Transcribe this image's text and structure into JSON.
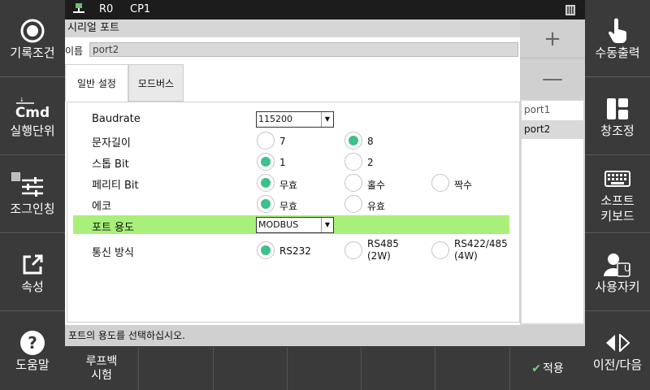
{
  "top_status": {
    "indicator_r": "R0",
    "indicator_cp": "CP1"
  },
  "left_sidebar": [
    {
      "label": "기록조건",
      "icon": "record-circle-icon"
    },
    {
      "label": "실행단위",
      "icon": "cmd-icon",
      "icon_text": "Cmd"
    },
    {
      "label": "조그인칭",
      "icon": "sliders-icon"
    },
    {
      "label": "속성",
      "icon": "external-link-icon"
    },
    {
      "label": "도움말",
      "icon": "help-icon"
    }
  ],
  "right_sidebar": [
    {
      "label": "수동출력",
      "icon": "hand-pointer-icon"
    },
    {
      "label": "창조정",
      "icon": "window-layout-icon"
    },
    {
      "label": "소프트\n키보드",
      "icon": "keyboard-icon"
    },
    {
      "label": "사용자키",
      "icon": "user-key-icon",
      "icon_text": "U"
    },
    {
      "label": "이전/다음",
      "icon": "prev-next-icon"
    }
  ],
  "window": {
    "title": "시리얼 포트",
    "name_label": "이름",
    "name_value": "port2"
  },
  "tabs": [
    {
      "label": "일반 설정",
      "active": true
    },
    {
      "label": "모드버스",
      "active": false
    }
  ],
  "settings": {
    "baudrate": {
      "label": "Baudrate",
      "value": "115200"
    },
    "char_length": {
      "label": "문자길이",
      "options": [
        "7",
        "8"
      ],
      "selected": "8"
    },
    "stop_bit": {
      "label": "스톱 Bit",
      "options": [
        "1",
        "2"
      ],
      "selected": "1"
    },
    "parity_bit": {
      "label": "페리티 Bit",
      "options": [
        "무효",
        "홀수",
        "짝수"
      ],
      "selected": "무효"
    },
    "echo": {
      "label": "에코",
      "options": [
        "무효",
        "유효"
      ],
      "selected": "무효"
    },
    "port_usage": {
      "label": "포트 용도",
      "value": "MODBUS"
    },
    "comm_method": {
      "label": "통신 방식",
      "options": [
        "RS232",
        "RS485\n(2W)",
        "RS422/485\n(4W)"
      ],
      "selected": "RS232"
    }
  },
  "side_controls": {
    "add": "+",
    "remove": "—"
  },
  "port_list": [
    {
      "label": "port1",
      "selected": false
    },
    {
      "label": "port2",
      "selected": true
    }
  ],
  "status_message": "포트의 용도를 선택하십시오.",
  "function_keys": {
    "loopback_test": "루프백\n시험",
    "apply": "적용",
    "apply_icon": "check-icon"
  },
  "colors": {
    "highlight": "#a9f07a",
    "radio_selected": "#3ec08a",
    "sidebar_bg": "#3a3a3a"
  }
}
